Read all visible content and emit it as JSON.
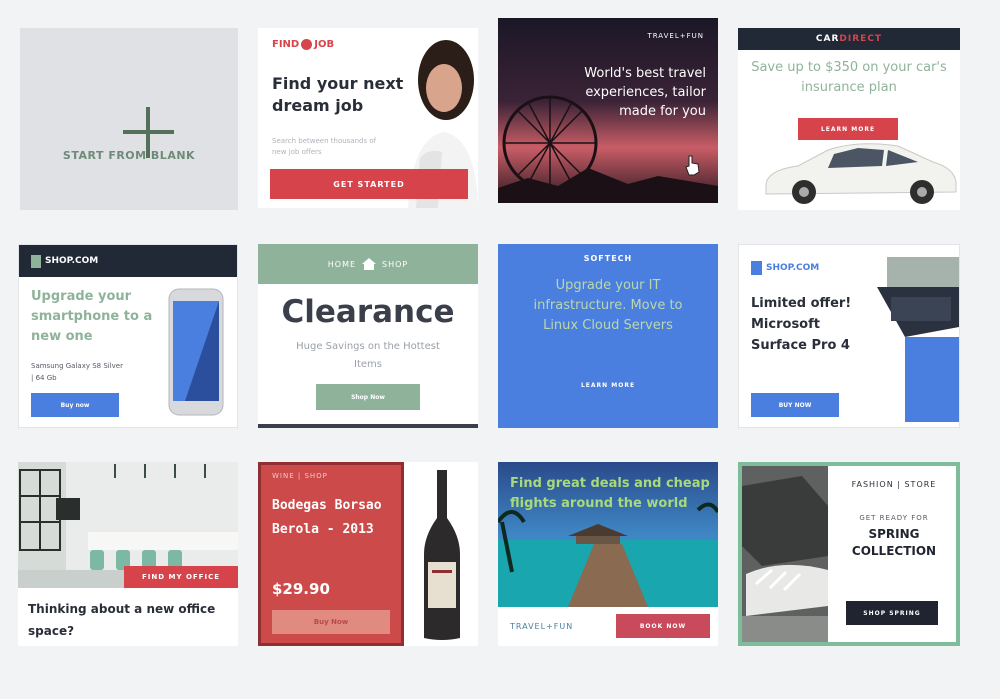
{
  "colors": {
    "page_bg": "#f2f3f5",
    "job_red": "#d7434b",
    "dark_navy": "#212836",
    "sage_green": "#8fb39a",
    "blue": "#4a7fdf",
    "wine_red": "#cd4a4b",
    "fashion_green": "#7fbd9a"
  },
  "blank": {
    "label": "START FROM BLANK",
    "icon": "plus-icon"
  },
  "findjob": {
    "brand_left": "FIND",
    "brand_right": "JOB",
    "headline": "Find your next dream job",
    "subtext": "Search between thousands of new job offers",
    "button": "GET STARTED"
  },
  "travel1": {
    "brand": "TRAVEL+FUN",
    "headline": "World's best travel experiences, tailor made for you"
  },
  "cardirect": {
    "brand_left": "CAR",
    "brand_right": "DIRECT",
    "headline": "Save up to $350 on your car's insurance plan",
    "button": "LEARN MORE"
  },
  "shop1": {
    "brand": "SHOP.COM",
    "headline": "Upgrade your smartphone to a new one",
    "subtext": "Samsung Galaxy S8 Silver | 64 Gb",
    "button": "Buy now"
  },
  "homeshop": {
    "brand_left": "HOME",
    "brand_right": "SHOP",
    "headline": "Clearance",
    "subtext": "Huge Savings on the Hottest Items",
    "button": "Shop Now"
  },
  "softech": {
    "brand": "SOFTECH",
    "headline": "Upgrade your IT infrastructure. Move to Linux Cloud Servers",
    "button": "LEARN MORE"
  },
  "shop2": {
    "brand": "SHOP.COM",
    "headline": "Limited offer! Microsoft Surface Pro 4",
    "button": "BUY NOW"
  },
  "office": {
    "tag": "FIND MY OFFICE",
    "headline": "Thinking about a new office space?"
  },
  "wine": {
    "brand": "WINE | SHOP",
    "headline": "Bodegas Borsao Berola - 2013",
    "price": "$29.90",
    "button": "Buy Now"
  },
  "travel2": {
    "headline": "Find great deals and cheap flights around the world",
    "brand": "TRAVEL+FUN",
    "button": "BOOK NOW"
  },
  "fashion": {
    "brand": "FASHION | STORE",
    "small": "GET READY FOR",
    "headline": "SPRING COLLECTION",
    "button": "SHOP SPRING"
  }
}
